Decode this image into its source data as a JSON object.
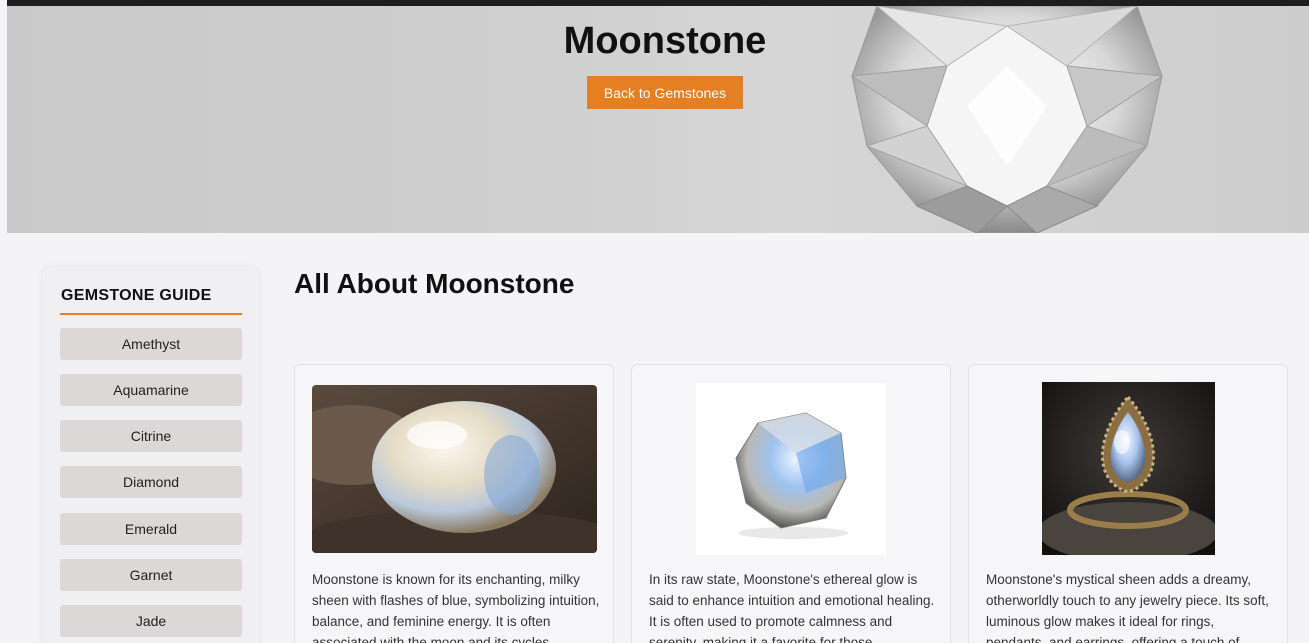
{
  "hero": {
    "title": "Moonstone",
    "back_button": "Back to Gemstones"
  },
  "sidebar": {
    "title": "GEMSTONE GUIDE",
    "items": [
      {
        "label": "Amethyst"
      },
      {
        "label": "Aquamarine"
      },
      {
        "label": "Citrine"
      },
      {
        "label": "Diamond"
      },
      {
        "label": "Emerald"
      },
      {
        "label": "Garnet"
      },
      {
        "label": "Jade"
      }
    ]
  },
  "main": {
    "title": "All About Moonstone",
    "cards": [
      {
        "text": "Moonstone is known for its enchanting, milky sheen with flashes of blue, symbolizing intuition, balance, and feminine energy. It is often associated with the moon and its cycles"
      },
      {
        "text": "In its raw state, Moonstone's ethereal glow is said to enhance intuition and emotional healing. It is often used to promote calmness and serenity, making it a favorite for those"
      },
      {
        "text": "Moonstone's mystical sheen adds a dreamy, otherworldly touch to any jewelry piece. Its soft, luminous glow makes it ideal for rings, pendants, and earrings, offering a touch of"
      }
    ]
  },
  "colors": {
    "accent": "#e67e22",
    "sidebar_item_bg": "#dcd8d8",
    "page_bg": "#f4f4f6"
  }
}
